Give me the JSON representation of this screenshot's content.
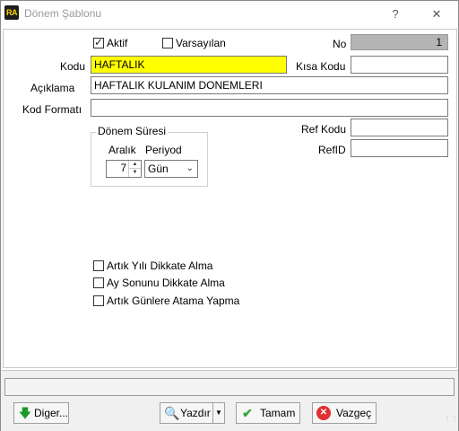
{
  "window": {
    "title": "Dönem Şablonu",
    "app_icon_text": "RA",
    "help_label": "?",
    "close_label": "✕"
  },
  "form": {
    "aktif": {
      "label": "Aktif",
      "checked": true
    },
    "varsayilan": {
      "label": "Varsayılan",
      "checked": false
    },
    "no": {
      "label": "No",
      "value": "1"
    },
    "kodu": {
      "label": "Kodu",
      "value": "HAFTALIK"
    },
    "kisa_kodu": {
      "label": "Kısa Kodu",
      "value": ""
    },
    "aciklama": {
      "label": "Açıklama",
      "value": "HAFTALIK KULANIM DONEMLERI"
    },
    "kod_formati": {
      "label": "Kod Formatı",
      "value": ""
    },
    "ref_kodu": {
      "label": "Ref Kodu",
      "value": ""
    },
    "ref_id": {
      "label": "RefID",
      "value": ""
    }
  },
  "donem_suresi": {
    "title": "Dönem Süresi",
    "aralik_label": "Aralık",
    "aralik_value": "7",
    "periyod_label": "Periyod",
    "periyod_value": "Gün"
  },
  "options": [
    {
      "label": "Artık Yılı Dikkate Alma",
      "checked": false
    },
    {
      "label": "Ay Sonunu Dikkate Alma",
      "checked": false
    },
    {
      "label": "Artık Günlere Atama Yapma",
      "checked": false
    }
  ],
  "buttons": {
    "diger": "Diger...",
    "yazdir": "Yazdır",
    "tamam": "Tamam",
    "vazgec": "Vazgeç"
  },
  "colors": {
    "kodu_bg": "#ffff00",
    "no_bg": "#b4b4b4"
  }
}
